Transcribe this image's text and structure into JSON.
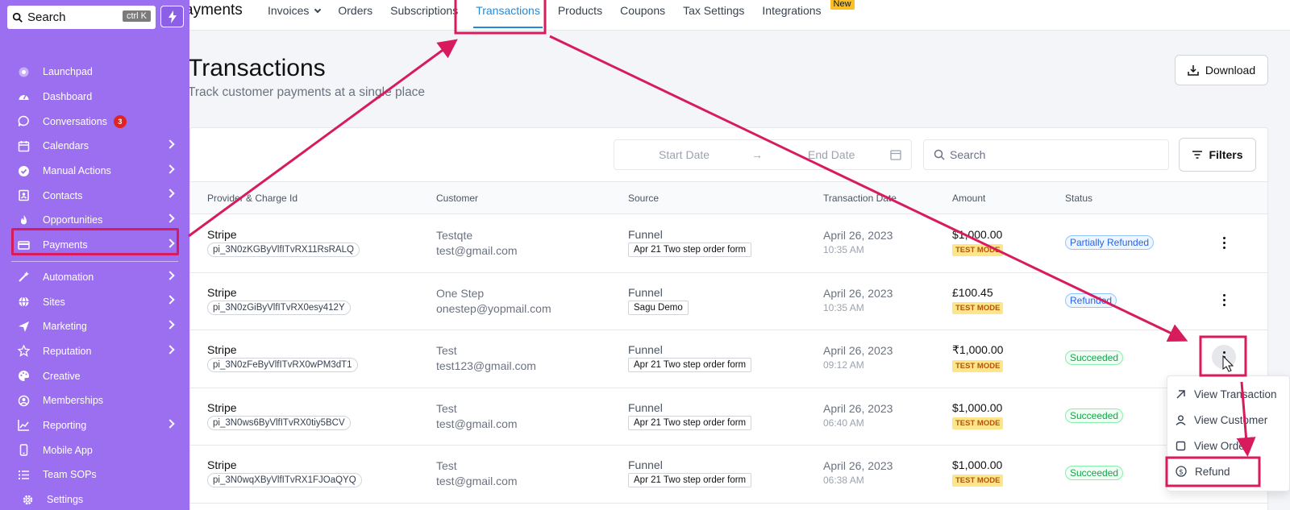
{
  "sidebar": {
    "search_label": "Search",
    "search_shortcut": "ctrl K",
    "items": [
      {
        "label": "Launchpad",
        "icon": "rocket-icon",
        "chevron": false
      },
      {
        "label": "Dashboard",
        "icon": "gauge-icon",
        "chevron": false
      },
      {
        "label": "Conversations",
        "icon": "chat-icon",
        "chevron": false,
        "badge": "3"
      },
      {
        "label": "Calendars",
        "icon": "calendar-icon",
        "chevron": true
      },
      {
        "label": "Manual Actions",
        "icon": "check-circle-icon",
        "chevron": true
      },
      {
        "label": "Contacts",
        "icon": "contact-book-icon",
        "chevron": true
      },
      {
        "label": "Opportunities",
        "icon": "flame-icon",
        "chevron": true
      },
      {
        "label": "Payments",
        "icon": "credit-card-icon",
        "chevron": true
      },
      {
        "label": "Automation",
        "icon": "wand-icon",
        "chevron": true
      },
      {
        "label": "Sites",
        "icon": "globe-icon",
        "chevron": true
      },
      {
        "label": "Marketing",
        "icon": "paper-plane-icon",
        "chevron": true
      },
      {
        "label": "Reputation",
        "icon": "star-icon",
        "chevron": true
      },
      {
        "label": "Creative",
        "icon": "palette-icon",
        "chevron": false
      },
      {
        "label": "Memberships",
        "icon": "user-circle-icon",
        "chevron": false
      },
      {
        "label": "Reporting",
        "icon": "chart-line-icon",
        "chevron": true
      },
      {
        "label": "Mobile App",
        "icon": "phone-icon",
        "chevron": false
      },
      {
        "label": "Team SOPs",
        "icon": "list-icon",
        "chevron": false
      },
      {
        "label": "Settings",
        "icon": "gear-icon",
        "chevron": false
      }
    ]
  },
  "topnav": {
    "app_title": "ayments",
    "tabs": [
      {
        "label": "Invoices",
        "dropdown": true
      },
      {
        "label": "Orders"
      },
      {
        "label": "Subscriptions"
      },
      {
        "label": "Transactions",
        "active": true
      },
      {
        "label": "Products"
      },
      {
        "label": "Coupons"
      },
      {
        "label": "Tax Settings"
      },
      {
        "label": "Integrations",
        "badge": "New"
      }
    ]
  },
  "page": {
    "title": "Transactions",
    "subtitle": "Track customer payments at a single place",
    "download_label": "Download"
  },
  "toolbar": {
    "start_date_placeholder": "Start Date",
    "end_date_placeholder": "End Date",
    "search_placeholder": "Search",
    "filters_label": "Filters"
  },
  "table": {
    "headers": {
      "provider": "Provider & Charge Id",
      "customer": "Customer",
      "source": "Source",
      "date": "Transaction Date",
      "amount": "Amount",
      "status": "Status"
    },
    "rows": [
      {
        "provider": "Stripe",
        "charge_id": "pi_3N0zKGByVlfITvRX11RsRALQ",
        "customer_name": "Testqte",
        "customer_email": "test@gmail.com",
        "source": "Funnel",
        "source_detail": "Apr 21 Two step order form",
        "date": "April 26, 2023",
        "time": "10:35 AM",
        "amount": "$1,000.00",
        "mode": "TEST MODE",
        "status": "Partially Refunded",
        "status_color": "#2563eb"
      },
      {
        "provider": "Stripe",
        "charge_id": "pi_3N0zGiByVlfITvRX0esy412Y",
        "customer_name": "One Step",
        "customer_email": "onestep@yopmail.com",
        "source": "Funnel",
        "source_detail": "Sagu Demo",
        "date": "April 26, 2023",
        "time": "10:35 AM",
        "amount": "£100.45",
        "mode": "TEST MODE",
        "status": "Refunded",
        "status_color": "#2563eb"
      },
      {
        "provider": "Stripe",
        "charge_id": "pi_3N0zFeByVlfITvRX0wPM3dT1",
        "customer_name": "Test",
        "customer_email": "test123@gmail.com",
        "source": "Funnel",
        "source_detail": "Apr 21 Two step order form",
        "date": "April 26, 2023",
        "time": "09:12 AM",
        "amount": "₹1,000.00",
        "mode": "TEST MODE",
        "status": "Succeeded",
        "status_color": "#16a34a"
      },
      {
        "provider": "Stripe",
        "charge_id": "pi_3N0ws6ByVlfITvRX0tiy5BCV",
        "customer_name": "Test",
        "customer_email": "test@gmail.com",
        "source": "Funnel",
        "source_detail": "Apr 21 Two step order form",
        "date": "April 26, 2023",
        "time": "06:40 AM",
        "amount": "$1,000.00",
        "mode": "TEST MODE",
        "status": "Succeeded",
        "status_color": "#16a34a"
      },
      {
        "provider": "Stripe",
        "charge_id": "pi_3N0wqXByVlfITvRX1FJOaQYQ",
        "customer_name": "Test",
        "customer_email": "test@gmail.com",
        "source": "Funnel",
        "source_detail": "Apr 21 Two step order form",
        "date": "April 26, 2023",
        "time": "06:38 AM",
        "amount": "$1,000.00",
        "mode": "TEST MODE",
        "status": "Succeeded",
        "status_color": "#16a34a"
      }
    ]
  },
  "row_menu": {
    "items": [
      {
        "label": "View Transaction",
        "icon": "arrow-up-right-icon"
      },
      {
        "label": "View Customer",
        "icon": "user-icon"
      },
      {
        "label": "View Order",
        "icon": "square-icon"
      },
      {
        "label": "Refund",
        "icon": "dollar-circle-icon"
      }
    ]
  },
  "colors": {
    "sidebar": "#9b6ff0",
    "accent": "#1d8ce0",
    "annotation": "#d81b5c",
    "test_mode_bg": "#fde68a"
  }
}
